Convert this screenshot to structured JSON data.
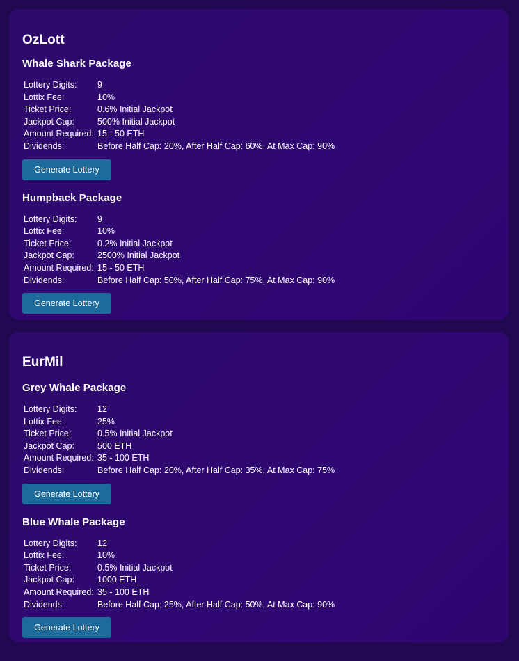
{
  "lotteries": [
    {
      "name": "OzLott",
      "packages": [
        {
          "name": "Whale Shark Package",
          "specs": [
            {
              "label": "Lottery Digits:",
              "value": "9"
            },
            {
              "label": "Lottix Fee:",
              "value": "10%"
            },
            {
              "label": "Ticket Price:",
              "value": "0.6% Initial Jackpot"
            },
            {
              "label": "Jackpot Cap:",
              "value": "500% Initial Jackpot"
            },
            {
              "label": "Amount Required:",
              "value": "15 - 50 ETH"
            },
            {
              "label": "Dividends:",
              "value": "Before Half Cap: 20%, After Half Cap: 60%, At Max Cap: 90%"
            }
          ],
          "button_label": "Generate Lottery"
        },
        {
          "name": "Humpback Package",
          "specs": [
            {
              "label": "Lottery Digits:",
              "value": "9"
            },
            {
              "label": "Lottix Fee:",
              "value": "10%"
            },
            {
              "label": "Ticket Price:",
              "value": "0.2% Initial Jackpot"
            },
            {
              "label": "Jackpot Cap:",
              "value": "2500% Initial Jackpot"
            },
            {
              "label": "Amount Required:",
              "value": "15 - 50 ETH"
            },
            {
              "label": "Dividends:",
              "value": "Before Half Cap: 50%, After Half Cap: 75%, At Max Cap: 90%"
            }
          ],
          "button_label": "Generate Lottery"
        }
      ]
    },
    {
      "name": "EurMil",
      "packages": [
        {
          "name": "Grey Whale Package",
          "specs": [
            {
              "label": "Lottery Digits:",
              "value": "12"
            },
            {
              "label": "Lottix Fee:",
              "value": "25%"
            },
            {
              "label": "Ticket Price:",
              "value": "0.5% Initial Jackpot"
            },
            {
              "label": "Jackpot Cap:",
              "value": "500 ETH"
            },
            {
              "label": "Amount Required:",
              "value": "35 - 100 ETH"
            },
            {
              "label": "Dividends:",
              "value": "Before Half Cap: 20%, After Half Cap: 35%, At Max Cap: 75%"
            }
          ],
          "button_label": "Generate Lottery"
        },
        {
          "name": "Blue Whale Package",
          "specs": [
            {
              "label": "Lottery Digits:",
              "value": "12"
            },
            {
              "label": "Lottix Fee:",
              "value": "10%"
            },
            {
              "label": "Ticket Price:",
              "value": "0.5% Initial Jackpot"
            },
            {
              "label": "Jackpot Cap:",
              "value": "1000 ETH"
            },
            {
              "label": "Amount Required:",
              "value": "35 - 100 ETH"
            },
            {
              "label": "Dividends:",
              "value": "Before Half Cap: 25%, After Half Cap: 50%, At Max Cap: 90%"
            }
          ],
          "button_label": "Generate Lottery"
        }
      ]
    }
  ],
  "colors": {
    "page_background": "#220850",
    "card_background": "#2f0870",
    "button_background": "#1d6b9b",
    "text": "#ffffff"
  }
}
